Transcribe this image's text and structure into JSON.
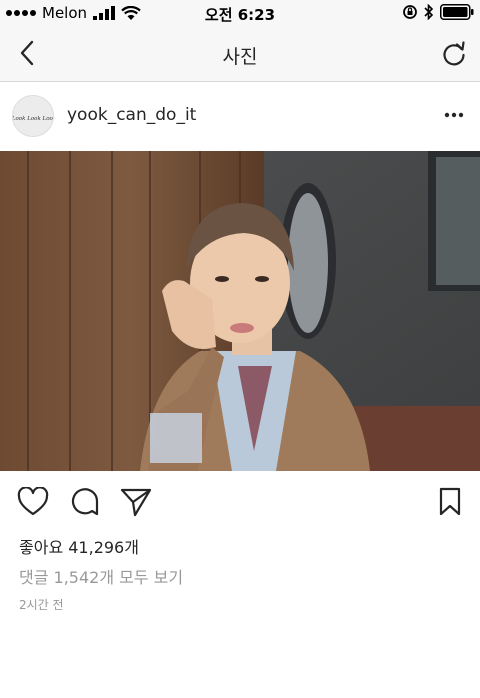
{
  "status_bar": {
    "carrier": "Melon",
    "time": "오전 6:23"
  },
  "nav": {
    "title": "사진",
    "back_icon": "chevron-left-icon",
    "refresh_icon": "refresh-icon"
  },
  "post": {
    "username": "yook_can_do_it",
    "avatar_text": "Look Look Look",
    "more_icon": "more-horizontal-icon"
  },
  "actions": {
    "like_icon": "heart-icon",
    "comment_icon": "comment-icon",
    "share_icon": "send-icon",
    "save_icon": "bookmark-icon"
  },
  "engagement": {
    "likes": "좋아요 41,296개",
    "view_comments": "댓글 1,542개 모두 보기",
    "time_ago": "2시간 전"
  }
}
